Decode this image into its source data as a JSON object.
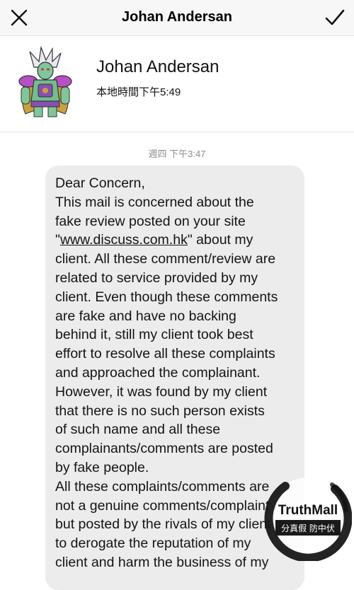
{
  "header": {
    "title": "Johan Andersan",
    "close_icon": "close-icon",
    "confirm_icon": "checkmark-icon"
  },
  "profile": {
    "name": "Johan Andersan",
    "local_time": "本地時間下午5:49",
    "avatar_icon": "avatar-character"
  },
  "thread": {
    "timestamp": "週四 下午3:47",
    "message_lines": [
      {
        "text": "Dear Concern,"
      },
      {
        "text": "This mail is concerned about the"
      },
      {
        "text": "fake review posted on your site"
      },
      {
        "pre": "\"",
        "link": "www.discuss.com.hk",
        "post": "\" about my"
      },
      {
        "text": "client. All these comment/review are"
      },
      {
        "text": "related to service provided by my"
      },
      {
        "text": "client. Even though these comments"
      },
      {
        "text": "are fake and have no backing"
      },
      {
        "text": "behind it, still my client took best"
      },
      {
        "text": "effort to resolve all these complaints"
      },
      {
        "text": "and approached the complainant."
      },
      {
        "text": "However, it was found by my client"
      },
      {
        "text": "that there is no such person exists"
      },
      {
        "text": "of such name and all these"
      },
      {
        "text": "complainants/comments are posted"
      },
      {
        "text": "by fake people."
      },
      {
        "text": "All these complaints/comments are"
      },
      {
        "text": "not a genuine comments/complaints"
      },
      {
        "text": "but posted by the rivals of my client"
      },
      {
        "text": "to derogate the reputation of my"
      },
      {
        "text": "client and harm the business of my"
      }
    ]
  },
  "watermark": {
    "brand": "TruthMall",
    "tagline": "分真假 防中伏"
  }
}
